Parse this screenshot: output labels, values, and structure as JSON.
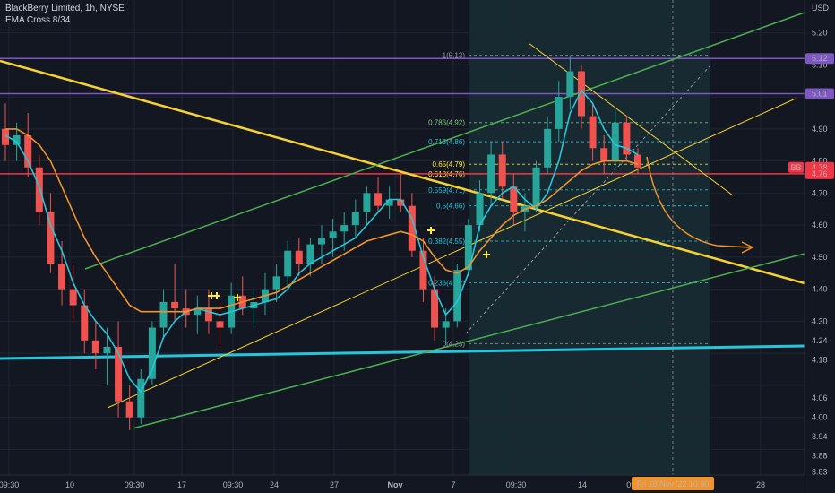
{
  "header": {
    "symbol_line": "BlackBerry Limited, 1h, NYSE",
    "indicator_line": "EMA Cross 8/34"
  },
  "chart_data": {
    "type": "candlestick",
    "title": "BlackBerry Limited, 1h, NYSE",
    "currency_label": "USD",
    "ylim": [
      3.82,
      5.28
    ],
    "y_ticks": [
      5.2,
      5.1,
      5.01,
      4.9,
      4.8,
      4.78,
      4.7,
      4.6,
      4.5,
      4.4,
      4.3,
      4.24,
      4.18,
      4.06,
      4.0,
      3.94,
      3.88,
      3.83
    ],
    "x_ticks": [
      "09:30",
      "10",
      "09:30",
      "17",
      "09:30",
      "24",
      "27",
      "Nov",
      "7",
      "09:30",
      "14",
      "09:3",
      "28"
    ],
    "crosshair_time_label": "Fri 18 Nov '22   10:30",
    "price_badges": [
      {
        "label": "5.12",
        "value": 5.12,
        "color": "#7e57c2"
      },
      {
        "label": "5.01",
        "value": 5.01,
        "color": "#7e57c2"
      },
      {
        "label": "4.78",
        "value": 4.78,
        "color": "#f23645"
      },
      {
        "label": "4.76",
        "value": 4.76,
        "color": "#f23645"
      }
    ],
    "tag_label": "BB",
    "horizontal_lines": [
      {
        "value": 5.12,
        "color": "#7e57c2"
      },
      {
        "value": 5.01,
        "color": "#7e57c2"
      },
      {
        "value": 4.76,
        "color": "#f23645"
      }
    ],
    "fib_levels": [
      {
        "label": "1(5.13)",
        "ratio": 1,
        "value": 5.13
      },
      {
        "label": "0.786(4.92)",
        "ratio": 0.786,
        "value": 4.92
      },
      {
        "label": "0.718(4.86)",
        "ratio": 0.718,
        "value": 4.86
      },
      {
        "label": "0.65(4.79)",
        "ratio": 0.65,
        "value": 4.79
      },
      {
        "label": "0.618(4.76)",
        "ratio": 0.618,
        "value": 4.76
      },
      {
        "label": "0.559(4.71)",
        "ratio": 0.559,
        "value": 4.71
      },
      {
        "label": "0.5(4.66)",
        "ratio": 0.5,
        "value": 4.66
      },
      {
        "label": "0.382(4.55)",
        "ratio": 0.382,
        "value": 4.55
      },
      {
        "label": "0.236(4.42)",
        "ratio": 0.236,
        "value": 4.42
      },
      {
        "label": "0(4.23)",
        "ratio": 0,
        "value": 4.23
      }
    ],
    "series": [
      {
        "name": "EMA 8",
        "color": "#26c6da",
        "values": [
          4.88,
          4.86,
          4.8,
          4.72,
          4.6,
          4.52,
          4.42,
          4.35,
          4.3,
          4.26,
          4.2,
          4.12,
          4.08,
          4.15,
          4.25,
          4.3,
          4.33,
          4.34,
          4.33,
          4.32,
          4.33,
          4.34,
          4.35,
          4.36,
          4.37,
          4.4,
          4.45,
          4.48,
          4.5,
          4.52,
          4.54,
          4.56,
          4.6,
          4.64,
          4.68,
          4.68,
          4.62,
          4.5,
          4.4,
          4.32,
          4.36,
          4.45,
          4.6,
          4.66,
          4.7,
          4.72,
          4.68,
          4.65,
          4.7,
          4.8,
          4.95,
          5.02,
          4.98,
          4.9,
          4.85,
          4.84,
          4.82
        ]
      },
      {
        "name": "EMA 34",
        "color": "#f0932b",
        "values": [
          4.9,
          4.9,
          4.88,
          4.85,
          4.8,
          4.72,
          4.64,
          4.56,
          4.5,
          4.45,
          4.4,
          4.35,
          4.33,
          4.33,
          4.33,
          4.33,
          4.33,
          4.34,
          4.34,
          4.34,
          4.35,
          4.36,
          4.37,
          4.38,
          4.39,
          4.41,
          4.43,
          4.45,
          4.47,
          4.49,
          4.51,
          4.53,
          4.55,
          4.56,
          4.57,
          4.58,
          4.57,
          4.55,
          4.5,
          4.46,
          4.45,
          4.47,
          4.52,
          4.56,
          4.6,
          4.63,
          4.65,
          4.66,
          4.68,
          4.71,
          4.74,
          4.77,
          4.79,
          4.8,
          4.8,
          4.8,
          4.79
        ]
      }
    ],
    "candles": [
      [
        4.9,
        4.98,
        4.8,
        4.85
      ],
      [
        4.85,
        4.92,
        4.8,
        4.88
      ],
      [
        4.88,
        4.95,
        4.75,
        4.78
      ],
      [
        4.78,
        4.82,
        4.6,
        4.64
      ],
      [
        4.64,
        4.7,
        4.45,
        4.48
      ],
      [
        4.48,
        4.55,
        4.35,
        4.4
      ],
      [
        4.4,
        4.48,
        4.3,
        4.35
      ],
      [
        4.35,
        4.4,
        4.2,
        4.24
      ],
      [
        4.24,
        4.3,
        4.15,
        4.2
      ],
      [
        4.2,
        4.28,
        4.1,
        4.22
      ],
      [
        4.22,
        4.3,
        4.0,
        4.05
      ],
      [
        4.05,
        4.1,
        3.96,
        4.0
      ],
      [
        4.0,
        4.15,
        3.98,
        4.12
      ],
      [
        4.12,
        4.3,
        4.1,
        4.28
      ],
      [
        4.28,
        4.4,
        4.25,
        4.36
      ],
      [
        4.36,
        4.48,
        4.3,
        4.34
      ],
      [
        4.34,
        4.4,
        4.28,
        4.32
      ],
      [
        4.32,
        4.38,
        4.26,
        4.34
      ],
      [
        4.34,
        4.4,
        4.26,
        4.3
      ],
      [
        4.3,
        4.36,
        4.22,
        4.28
      ],
      [
        4.28,
        4.42,
        4.26,
        4.38
      ],
      [
        4.38,
        4.44,
        4.32,
        4.34
      ],
      [
        4.34,
        4.4,
        4.28,
        4.36
      ],
      [
        4.36,
        4.45,
        4.32,
        4.4
      ],
      [
        4.4,
        4.48,
        4.36,
        4.44
      ],
      [
        4.44,
        4.55,
        4.4,
        4.52
      ],
      [
        4.52,
        4.56,
        4.44,
        4.48
      ],
      [
        4.48,
        4.56,
        4.44,
        4.54
      ],
      [
        4.54,
        4.6,
        4.48,
        4.56
      ],
      [
        4.56,
        4.62,
        4.5,
        4.58
      ],
      [
        4.58,
        4.64,
        4.52,
        4.6
      ],
      [
        4.6,
        4.68,
        4.56,
        4.64
      ],
      [
        4.64,
        4.72,
        4.6,
        4.7
      ],
      [
        4.7,
        4.75,
        4.64,
        4.66
      ],
      [
        4.66,
        4.72,
        4.62,
        4.68
      ],
      [
        4.68,
        4.76,
        4.64,
        4.66
      ],
      [
        4.66,
        4.7,
        4.5,
        4.52
      ],
      [
        4.52,
        4.56,
        4.36,
        4.4
      ],
      [
        4.4,
        4.44,
        4.24,
        4.28
      ],
      [
        4.28,
        4.34,
        4.23,
        4.3
      ],
      [
        4.3,
        4.48,
        4.28,
        4.46
      ],
      [
        4.46,
        4.62,
        4.44,
        4.6
      ],
      [
        4.6,
        4.74,
        4.58,
        4.7
      ],
      [
        4.7,
        4.86,
        4.66,
        4.82
      ],
      [
        4.82,
        4.86,
        4.68,
        4.72
      ],
      [
        4.72,
        4.76,
        4.6,
        4.64
      ],
      [
        4.64,
        4.7,
        4.58,
        4.66
      ],
      [
        4.66,
        4.8,
        4.64,
        4.78
      ],
      [
        4.78,
        4.94,
        4.76,
        4.9
      ],
      [
        4.9,
        5.05,
        4.86,
        5.0
      ],
      [
        5.0,
        5.13,
        4.96,
        5.08
      ],
      [
        5.08,
        5.1,
        4.9,
        4.94
      ],
      [
        4.94,
        4.98,
        4.8,
        4.84
      ],
      [
        4.84,
        4.88,
        4.76,
        4.8
      ],
      [
        4.8,
        4.96,
        4.78,
        4.92
      ],
      [
        4.92,
        4.94,
        4.8,
        4.82
      ],
      [
        4.82,
        4.84,
        4.76,
        4.78
      ]
    ]
  }
}
